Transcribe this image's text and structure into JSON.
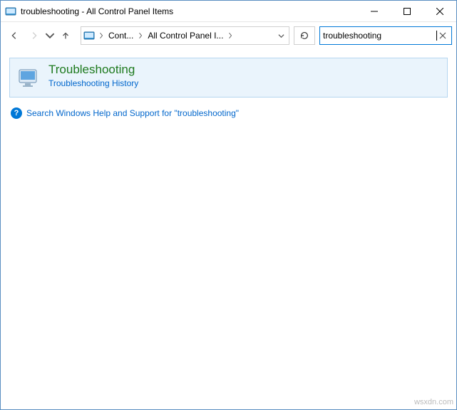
{
  "window": {
    "title": "troubleshooting - All Control Panel Items"
  },
  "address": {
    "seg1": "Cont...",
    "seg2": "All Control Panel I..."
  },
  "search": {
    "value": "troubleshooting"
  },
  "result": {
    "title": "Troubleshooting",
    "subtitle": "Troubleshooting History"
  },
  "help": {
    "text": "Search Windows Help and Support for \"troubleshooting\""
  },
  "watermark": "wsxdn.com"
}
